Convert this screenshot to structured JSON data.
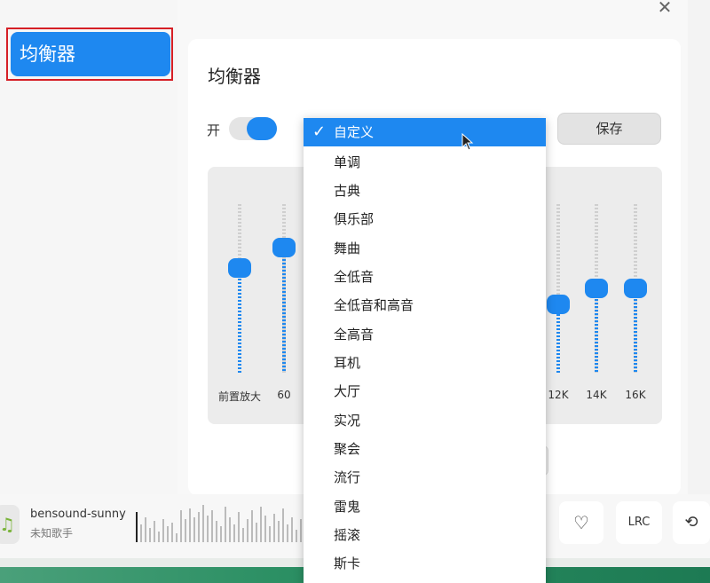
{
  "sidebar": {
    "items": [
      {
        "label": "均衡器"
      }
    ]
  },
  "window": {
    "close_icon": "close-icon"
  },
  "equalizer": {
    "title": "均衡器",
    "switch_label": "开",
    "switch_on": true,
    "save_label": "保存",
    "preset_selected": "自定义",
    "presets": [
      "自定义",
      "单调",
      "古典",
      "俱乐部",
      "舞曲",
      "全低音",
      "全低音和高音",
      "全高音",
      "耳机",
      "大厅",
      "实况",
      "聚会",
      "流行",
      "雷鬼",
      "摇滚",
      "斯卡"
    ],
    "bands": [
      {
        "label": "前置放大",
        "level": 0.62
      },
      {
        "label": "60",
        "level": 0.78
      },
      {
        "label": "12K",
        "level": 0.41
      },
      {
        "label": "14K",
        "level": 0.5
      },
      {
        "label": "16K",
        "level": 0.5
      }
    ]
  },
  "player": {
    "song_title": "bensound-sunny",
    "artist": "未知歌手",
    "lrc_label": "LRC",
    "icons": [
      "music-note-icon",
      "heart-icon",
      "repeat-icon"
    ]
  },
  "colors": {
    "accent": "#1e88f0",
    "highlight_border": "#d61f26"
  }
}
